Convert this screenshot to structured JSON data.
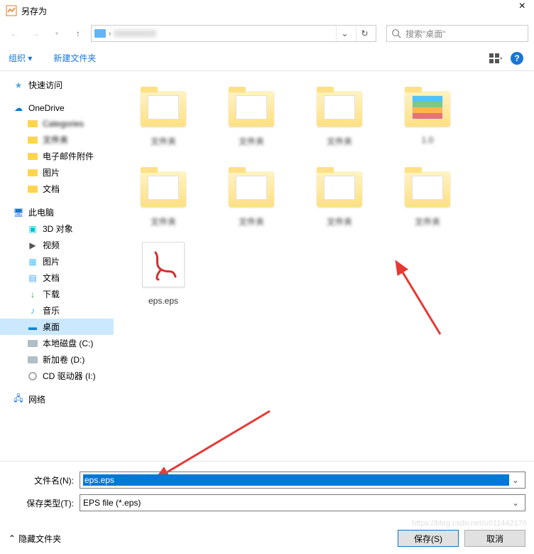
{
  "window": {
    "title": "另存为"
  },
  "nav": {
    "search_placeholder": "搜索\"桌面\""
  },
  "toolbar": {
    "organize": "组织 ▾",
    "new_folder": "新建文件夹"
  },
  "sidebar": {
    "quick_access": "快速访问",
    "onedrive": "OneDrive",
    "folder_a": "电子邮件附件",
    "folder_b": "图片",
    "folder_c": "文档",
    "this_pc": "此电脑",
    "objects_3d": "3D 对象",
    "videos": "视频",
    "pictures": "图片",
    "documents": "文档",
    "downloads": "下载",
    "music": "音乐",
    "desktop": "桌面",
    "disk_c": "本地磁盘 (C:)",
    "disk_d": "新加卷 (D:)",
    "disk_i": "CD 驱动器 (I:)",
    "network": "网络"
  },
  "files": {
    "eps_label": "eps.eps",
    "blur1": "文件夹",
    "blur2": "文件夹",
    "blur3": "文件夹",
    "blur4": "1.0",
    "blur5": "文件夹",
    "blur6": "文件夹",
    "blur7": "文件夹",
    "blur8": "文件夹"
  },
  "form": {
    "filename_label": "文件名(N):",
    "filename_value": "eps.eps",
    "type_label": "保存类型(T):",
    "type_value": "EPS file (*.eps)"
  },
  "footer": {
    "hide": "隐藏文件夹",
    "save": "保存(S)",
    "cancel": "取消"
  },
  "watermark": "https://blog.csdn.net/u011442170"
}
